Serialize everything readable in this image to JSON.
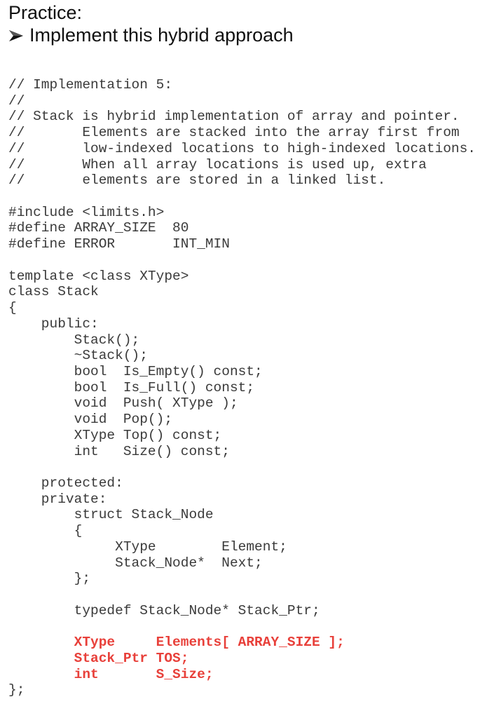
{
  "slide": {
    "title": "Practice:",
    "bullet_icon": "arrowhead-bullet-icon",
    "bullet_text": "Implement this hybrid approach"
  },
  "colors": {
    "text": "#111111",
    "code": "#3a3a3a",
    "highlight": "#e8403a"
  },
  "code": {
    "lines": [
      {
        "text": "// Implementation 5:",
        "highlight": false
      },
      {
        "text": "//",
        "highlight": false
      },
      {
        "text": "// Stack is hybrid implementation of array and pointer.",
        "highlight": false
      },
      {
        "text": "//       Elements are stacked into the array first from",
        "highlight": false
      },
      {
        "text": "//       low-indexed locations to high-indexed locations.",
        "highlight": false
      },
      {
        "text": "//       When all array locations is used up, extra",
        "highlight": false
      },
      {
        "text": "//       elements are stored in a linked list.",
        "highlight": false
      },
      {
        "text": "",
        "highlight": false
      },
      {
        "text": "#include <limits.h>",
        "highlight": false
      },
      {
        "text": "#define ARRAY_SIZE  80",
        "highlight": false
      },
      {
        "text": "#define ERROR       INT_MIN",
        "highlight": false
      },
      {
        "text": "",
        "highlight": false
      },
      {
        "text": "template <class XType>",
        "highlight": false
      },
      {
        "text": "class Stack",
        "highlight": false
      },
      {
        "text": "{",
        "highlight": false
      },
      {
        "text": "    public:",
        "highlight": false
      },
      {
        "text": "        Stack();",
        "highlight": false
      },
      {
        "text": "        ~Stack();",
        "highlight": false
      },
      {
        "text": "        bool  Is_Empty() const;",
        "highlight": false
      },
      {
        "text": "        bool  Is_Full() const;",
        "highlight": false
      },
      {
        "text": "        void  Push( XType );",
        "highlight": false
      },
      {
        "text": "        void  Pop();",
        "highlight": false
      },
      {
        "text": "        XType Top() const;",
        "highlight": false
      },
      {
        "text": "        int   Size() const;",
        "highlight": false
      },
      {
        "text": "",
        "highlight": false
      },
      {
        "text": "    protected:",
        "highlight": false
      },
      {
        "text": "    private:",
        "highlight": false
      },
      {
        "text": "        struct Stack_Node",
        "highlight": false
      },
      {
        "text": "        {",
        "highlight": false
      },
      {
        "text": "             XType        Element;",
        "highlight": false
      },
      {
        "text": "             Stack_Node*  Next;",
        "highlight": false
      },
      {
        "text": "        };",
        "highlight": false
      },
      {
        "text": "",
        "highlight": false
      },
      {
        "text": "        typedef Stack_Node* Stack_Ptr;",
        "highlight": false
      },
      {
        "text": "",
        "highlight": false
      },
      {
        "text": "        XType     Elements[ ARRAY_SIZE ];",
        "highlight": true
      },
      {
        "text": "        Stack_Ptr TOS;",
        "highlight": true
      },
      {
        "text": "        int       S_Size;",
        "highlight": true
      },
      {
        "text": "};",
        "highlight": false
      }
    ]
  }
}
